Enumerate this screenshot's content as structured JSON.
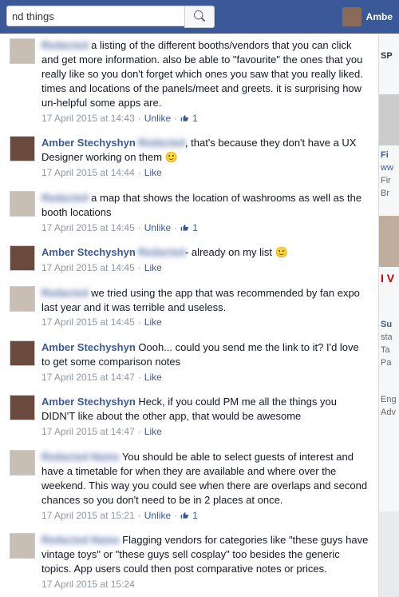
{
  "topbar": {
    "search_value": "nd things",
    "user_name": "Ambe"
  },
  "actions": {
    "unlike": "Unlike",
    "like": "Like"
  },
  "rightcol": {
    "sp": "SP",
    "fi": "Fi",
    "ww": "ww",
    "fir": "Fir",
    "br": "Br",
    "iv": "I V",
    "su": "Su",
    "sta": "sta",
    "ta": "Ta",
    "pa": "Pa",
    "eng": "Eng",
    "adv": "Adv"
  },
  "comments": [
    {
      "author": "Redacted",
      "obscured": true,
      "avatar": "other",
      "text": "a listing of the different booths/vendors that you can click and get more information. also be able to \"favourite\" the ones that you really like so you don't forget which ones you saw that you really liked. times and locations of the panels/meet and greets. it is surprising how un-helpful some apps are.",
      "timestamp": "17 April 2015 at 14:43",
      "action": "unlike",
      "like_count": "1"
    },
    {
      "author": "Amber Stechyshyn",
      "obscured": false,
      "avatar": "amber",
      "mention": "Redacted",
      "text": ", that's because they don't have a UX Designer working on them",
      "emoji": "🙂",
      "timestamp": "17 April 2015 at 14:44",
      "action": "like"
    },
    {
      "author": "Redacted",
      "obscured": true,
      "avatar": "other",
      "text": "a map that shows the location of washrooms as well as the booth locations",
      "timestamp": "17 April 2015 at 14:45",
      "action": "unlike",
      "like_count": "1"
    },
    {
      "author": "Amber Stechyshyn",
      "obscured": false,
      "avatar": "amber",
      "mention": "Redacted",
      "text": "- already on my list",
      "emoji": "🙂",
      "timestamp": "17 April 2015 at 14:45",
      "action": "like"
    },
    {
      "author": "Redacted",
      "obscured": true,
      "avatar": "other",
      "text": "we tried using the app that was recommended by fan expo last year and it was terrible and useless.",
      "timestamp": "17 April 2015 at 14:45",
      "action": "like"
    },
    {
      "author": "Amber Stechyshyn",
      "obscured": false,
      "avatar": "amber",
      "text": "Oooh... could you send me the link to it? I'd love to get some comparison notes",
      "timestamp": "17 April 2015 at 14:47",
      "action": "like"
    },
    {
      "author": "Amber Stechyshyn",
      "obscured": false,
      "avatar": "amber",
      "text": "Heck, if you could PM me all the things you DIDN'T like about the other app, that would be awesome",
      "timestamp": "17 April 2015 at 14:47",
      "action": "like"
    },
    {
      "author": "Redacted Name",
      "obscured": true,
      "avatar": "other",
      "text": "You should be able to select guests of interest and have a timetable for when they are available and where over the weekend. This way you could see when there are overlaps and second chances so you don't need to be in 2 places at once.",
      "timestamp": "17 April 2015 at 15:21",
      "action": "unlike",
      "like_count": "1"
    },
    {
      "author": "Redacted Name",
      "obscured": true,
      "avatar": "other",
      "text": "Flagging vendors for categories like \"these guys have vintage toys\" or \"these guys sell cosplay\" too besides the generic topics. App users could then post comparative notes or prices.",
      "timestamp": "17 April 2015 at 15:24",
      "action": "like",
      "cutoff": true
    }
  ]
}
